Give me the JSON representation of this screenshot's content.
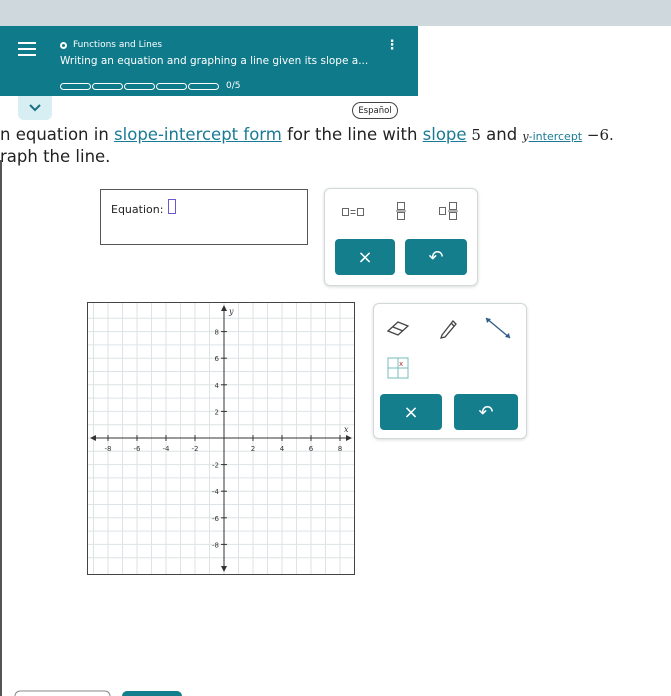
{
  "header": {
    "topic": "Functions and Lines",
    "subtitle": "Writing an equation and graphing a line given its slope a...",
    "progress_text": "0/5",
    "more_icon": "kebab-icon"
  },
  "language_button": "Español",
  "question": {
    "line1_start": "n equation in ",
    "line1_link1": "slope-intercept form",
    "line1_mid": " for the line with ",
    "line1_link2": "slope",
    "line1_slope": " 5",
    "line1_and": " and ",
    "line1_y": "y",
    "line1_link3": "-intercept",
    "line1_intercept": " −6.",
    "line2": "raph the line."
  },
  "equation": {
    "label": "Equation:"
  },
  "math_tools": {
    "equals_icon": "box-equals-box-icon",
    "fraction_icon": "fraction-icon",
    "mixed_icon": "mixed-number-icon",
    "clear_label": "×",
    "undo_label": "↶"
  },
  "graph": {
    "x_label": "x",
    "y_label": "y",
    "x_ticks": [
      "-8",
      "-6",
      "-4",
      "-2",
      "2",
      "4",
      "6",
      "8"
    ],
    "y_ticks": [
      "8",
      "6",
      "4",
      "2",
      "-2",
      "-4",
      "-6",
      "-8"
    ],
    "range": [
      -9,
      9
    ]
  },
  "graph_tools": {
    "eraser_icon": "eraser-icon",
    "pencil_icon": "pencil-icon",
    "line_icon": "line-tool-icon",
    "point_icon": "point-plot-icon",
    "clear_label": "×",
    "undo_label": "↶"
  }
}
